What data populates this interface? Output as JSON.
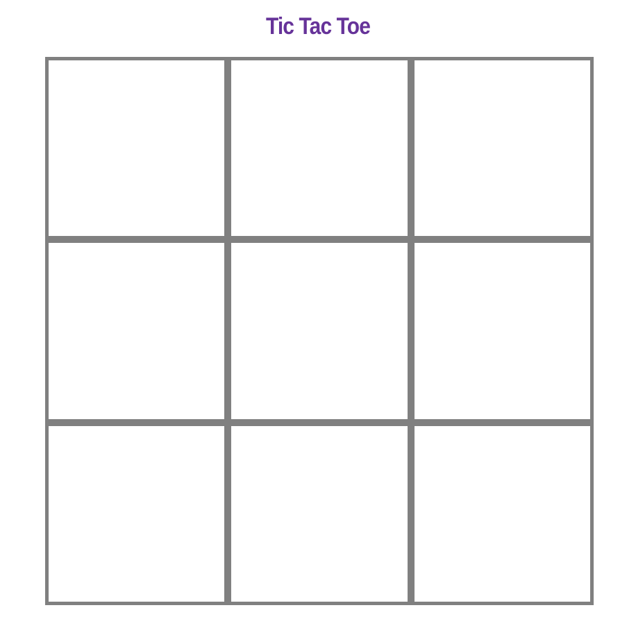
{
  "game": {
    "title": "Tic Tac Toe",
    "cells": [
      "",
      "",
      "",
      "",
      "",
      "",
      "",
      "",
      ""
    ]
  },
  "colors": {
    "title": "#663399",
    "grid": "#808080",
    "background": "#ffffff"
  }
}
